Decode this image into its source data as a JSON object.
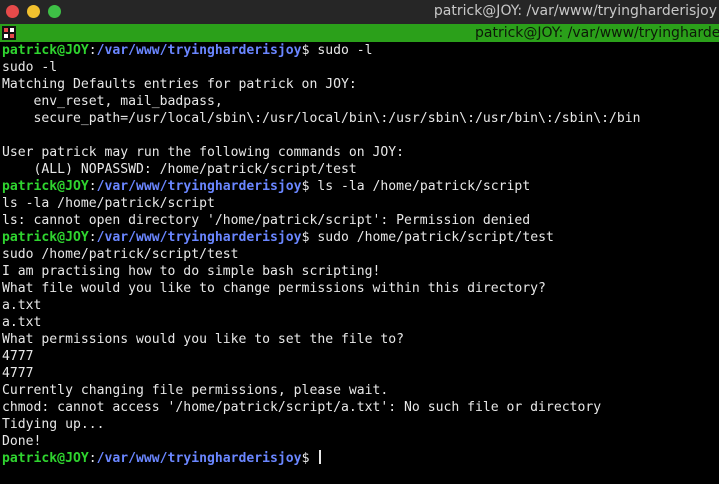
{
  "window": {
    "title": "patrick@JOY: /var/www/tryingharderisjoy"
  },
  "tab": {
    "title": "patrick@JOY: /var/www/tryingharderisjoy"
  },
  "colors": {
    "prompt_user": "#2fd42f",
    "prompt_path": "#6a86ff",
    "tab_bar": "#2ba01a",
    "text": "#e8e8e8"
  },
  "prompt": {
    "user": "patrick@JOY",
    "sep": ":",
    "path": "/var/www/tryingharderisjoy",
    "dollar": "$"
  },
  "terminal": {
    "lines": [
      {
        "type": "prompt",
        "cmd": " sudo -l"
      },
      {
        "type": "text",
        "text": "sudo -l"
      },
      {
        "type": "text",
        "text": "Matching Defaults entries for patrick on JOY:"
      },
      {
        "type": "text",
        "text": "    env_reset, mail_badpass,"
      },
      {
        "type": "text",
        "text": "    secure_path=/usr/local/sbin\\:/usr/local/bin\\:/usr/sbin\\:/usr/bin\\:/sbin\\:/bin"
      },
      {
        "type": "text",
        "text": ""
      },
      {
        "type": "text",
        "text": "User patrick may run the following commands on JOY:"
      },
      {
        "type": "text",
        "text": "    (ALL) NOPASSWD: /home/patrick/script/test"
      },
      {
        "type": "prompt",
        "cmd": " ls -la /home/patrick/script"
      },
      {
        "type": "text",
        "text": "ls -la /home/patrick/script"
      },
      {
        "type": "text",
        "text": "ls: cannot open directory '/home/patrick/script': Permission denied"
      },
      {
        "type": "prompt",
        "cmd": " sudo /home/patrick/script/test"
      },
      {
        "type": "text",
        "text": "sudo /home/patrick/script/test"
      },
      {
        "type": "text",
        "text": "I am practising how to do simple bash scripting!"
      },
      {
        "type": "text",
        "text": "What file would you like to change permissions within this directory?"
      },
      {
        "type": "text",
        "text": "a.txt"
      },
      {
        "type": "text",
        "text": "a.txt"
      },
      {
        "type": "text",
        "text": "What permissions would you like to set the file to?"
      },
      {
        "type": "text",
        "text": "4777"
      },
      {
        "type": "text",
        "text": "4777"
      },
      {
        "type": "text",
        "text": "Currently changing file permissions, please wait."
      },
      {
        "type": "text",
        "text": "chmod: cannot access '/home/patrick/script/a.txt': No such file or directory"
      },
      {
        "type": "text",
        "text": "Tidying up..."
      },
      {
        "type": "text",
        "text": "Done!"
      },
      {
        "type": "prompt",
        "cmd": " ",
        "cursor": true
      }
    ]
  }
}
